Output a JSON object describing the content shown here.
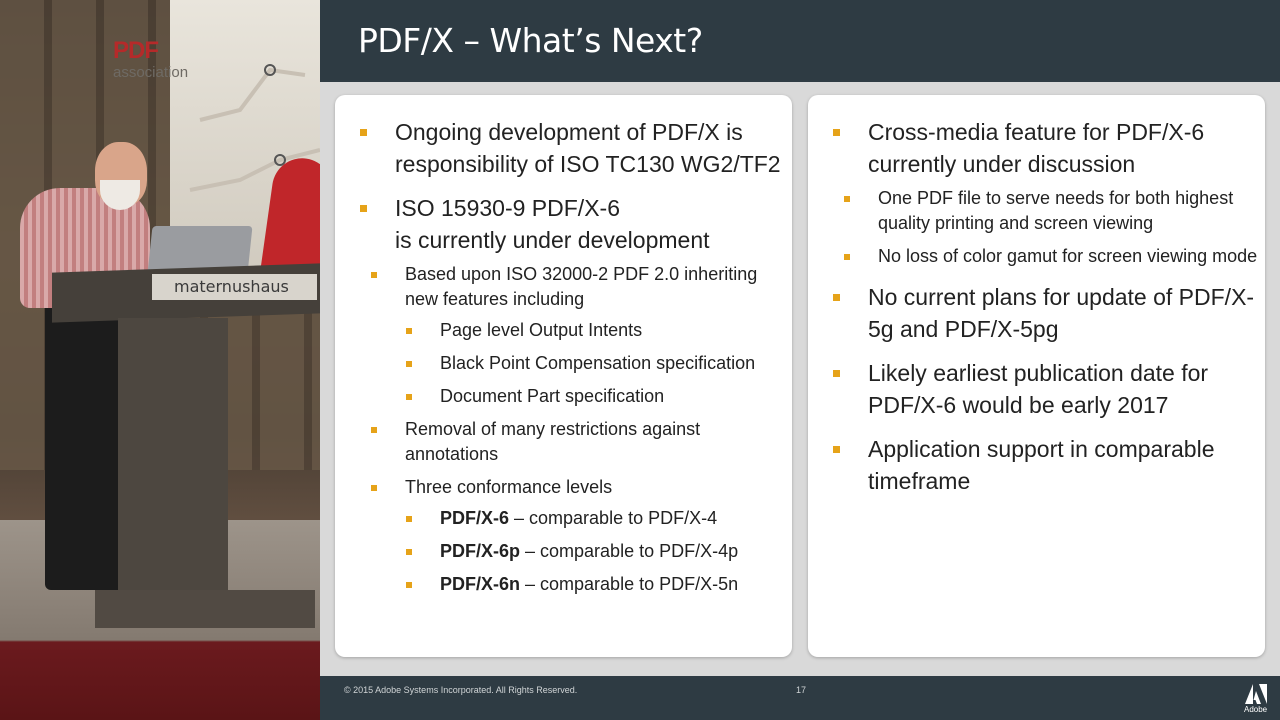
{
  "stage": {
    "banner_logo_top": "PDF",
    "banner_logo_bottom": "association",
    "podium_label": "maternushaus"
  },
  "slide": {
    "title": "PDF/X – What’s Next?",
    "left_panel": [
      {
        "text": "Ongoing development of PDF/X is responsibility of ISO TC130 WG2/TF2"
      },
      {
        "text_line1": "ISO 15930-9 PDF/X-6",
        "text_line2": "is currently under development",
        "children": [
          {
            "text": "Based upon ISO 32000-2 PDF 2.0 inheriting new features including",
            "children": [
              {
                "text": "Page level Output Intents"
              },
              {
                "text": "Black Point Compensation specification"
              },
              {
                "text": "Document Part specification"
              }
            ]
          },
          {
            "text": "Removal of many restrictions against annotations"
          },
          {
            "text": "Three conformance levels",
            "children": [
              {
                "bold": "PDF/X-6",
                "rest": " – comparable to PDF/X-4"
              },
              {
                "bold": "PDF/X-6p",
                "rest": " – comparable to PDF/X-4p"
              },
              {
                "bold": "PDF/X-6n",
                "rest": " – comparable to PDF/X-5n"
              }
            ]
          }
        ]
      }
    ],
    "right_panel": [
      {
        "text": "Cross-media feature for PDF/X-6 currently under discussion",
        "children": [
          {
            "text": "One PDF file to serve needs for both highest quality printing and screen viewing"
          },
          {
            "text": "No loss of color gamut for screen viewing mode"
          }
        ]
      },
      {
        "text": "No current plans for update of PDF/X-5g and PDF/X-5pg"
      },
      {
        "text": "Likely earliest publication date for PDF/X-6 would be early 2017"
      },
      {
        "text": "Application support in comparable timeframe"
      }
    ],
    "footer": {
      "copyright": "© 2015 Adobe Systems Incorporated. All Rights Reserved.",
      "page_number": "17",
      "brand": "Adobe"
    },
    "bullet_color": "#e6a319",
    "header_color": "#2e3b43"
  }
}
